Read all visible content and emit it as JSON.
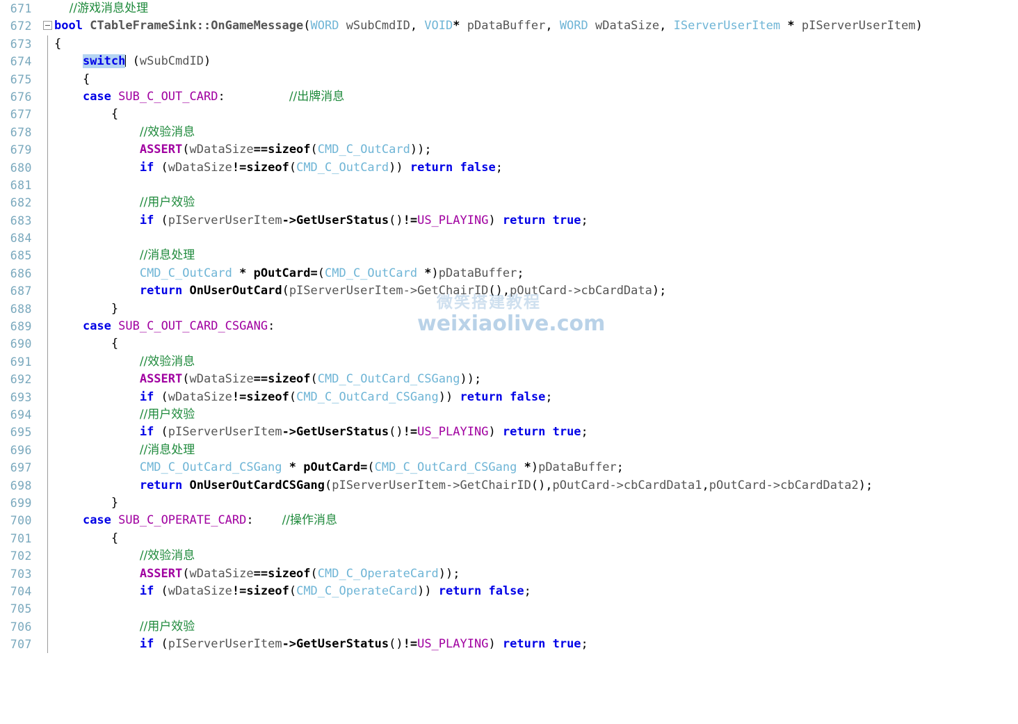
{
  "editor": {
    "name": "source-code-editor",
    "language": "C++",
    "first_line_number": 671,
    "last_line_number": 707,
    "colors": {
      "background": "#ffffff",
      "line_number": "#79a8bd",
      "keyword": "#0000e6",
      "comment": "#1f8a3c",
      "type": "#6fb5d6",
      "macro": "#a000a0",
      "identifier": "#555555",
      "selection": "#b4d3f2",
      "fold_line": "#9a9a9a"
    },
    "selection": {
      "text": "switch",
      "line_number": 674
    }
  },
  "watermark": {
    "chinese": "微笑搭建教程",
    "url": "weixiaolive.com"
  },
  "gutter": {
    "numbers": [
      671,
      672,
      673,
      674,
      675,
      676,
      677,
      678,
      679,
      680,
      681,
      682,
      683,
      684,
      685,
      686,
      687,
      688,
      689,
      690,
      691,
      692,
      693,
      694,
      695,
      696,
      697,
      698,
      699,
      700,
      701,
      702,
      703,
      704,
      705,
      706,
      707
    ],
    "fold_marker_line": 672,
    "fold_marker_glyph": "minus-box"
  },
  "code_lines": [
    {
      "n": 671,
      "text": "    //游戏消息处理"
    },
    {
      "n": 672,
      "text": "bool CTableFrameSink::OnGameMessage(WORD wSubCmdID, VOID* pDataBuffer, WORD wDataSize, IServerUserItem * pIServerUserItem)"
    },
    {
      "n": 673,
      "text": "{"
    },
    {
      "n": 674,
      "text": "    switch (wSubCmdID)"
    },
    {
      "n": 675,
      "text": "    {"
    },
    {
      "n": 676,
      "text": "    case SUB_C_OUT_CARD:         //出牌消息"
    },
    {
      "n": 677,
      "text": "        {"
    },
    {
      "n": 678,
      "text": "            //效验消息"
    },
    {
      "n": 679,
      "text": "            ASSERT(wDataSize==sizeof(CMD_C_OutCard));"
    },
    {
      "n": 680,
      "text": "            if (wDataSize!=sizeof(CMD_C_OutCard)) return false;"
    },
    {
      "n": 681,
      "text": ""
    },
    {
      "n": 682,
      "text": "            //用户效验"
    },
    {
      "n": 683,
      "text": "            if (pIServerUserItem->GetUserStatus()!=US_PLAYING) return true;"
    },
    {
      "n": 684,
      "text": ""
    },
    {
      "n": 685,
      "text": "            //消息处理"
    },
    {
      "n": 686,
      "text": "            CMD_C_OutCard * pOutCard=(CMD_C_OutCard *)pDataBuffer;"
    },
    {
      "n": 687,
      "text": "            return OnUserOutCard(pIServerUserItem->GetChairID(),pOutCard->cbCardData);"
    },
    {
      "n": 688,
      "text": "        }"
    },
    {
      "n": 689,
      "text": "    case SUB_C_OUT_CARD_CSGANG:"
    },
    {
      "n": 690,
      "text": "        {"
    },
    {
      "n": 691,
      "text": "            //效验消息"
    },
    {
      "n": 692,
      "text": "            ASSERT(wDataSize==sizeof(CMD_C_OutCard_CSGang));"
    },
    {
      "n": 693,
      "text": "            if (wDataSize!=sizeof(CMD_C_OutCard_CSGang)) return false;"
    },
    {
      "n": 694,
      "text": "            //用户效验"
    },
    {
      "n": 695,
      "text": "            if (pIServerUserItem->GetUserStatus()!=US_PLAYING) return true;"
    },
    {
      "n": 696,
      "text": "            //消息处理"
    },
    {
      "n": 697,
      "text": "            CMD_C_OutCard_CSGang * pOutCard=(CMD_C_OutCard_CSGang *)pDataBuffer;"
    },
    {
      "n": 698,
      "text": "            return OnUserOutCardCSGang(pIServerUserItem->GetChairID(),pOutCard->cbCardData1,pOutCard->cbCardData2);"
    },
    {
      "n": 699,
      "text": "        }"
    },
    {
      "n": 700,
      "text": "    case SUB_C_OPERATE_CARD:    //操作消息"
    },
    {
      "n": 701,
      "text": "        {"
    },
    {
      "n": 702,
      "text": "            //效验消息"
    },
    {
      "n": 703,
      "text": "            ASSERT(wDataSize==sizeof(CMD_C_OperateCard));"
    },
    {
      "n": 704,
      "text": "            if (wDataSize!=sizeof(CMD_C_OperateCard)) return false;"
    },
    {
      "n": 705,
      "text": ""
    },
    {
      "n": 706,
      "text": "            //用户效验"
    },
    {
      "n": 707,
      "text": "            if (pIServerUserItem->GetUserStatus()!=US_PLAYING) return true;"
    }
  ]
}
